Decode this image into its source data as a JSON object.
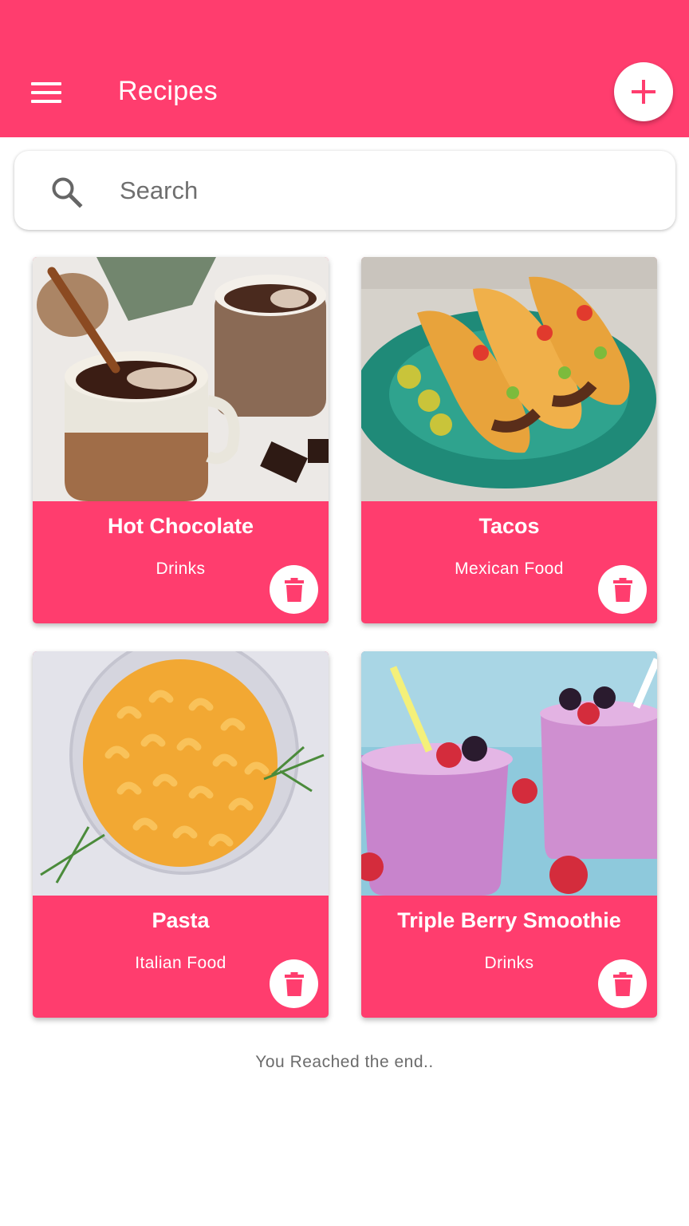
{
  "app_bar": {
    "title": "Recipes",
    "menu_icon": "hamburger-menu-icon",
    "add_icon": "plus-icon",
    "color": "#ff3d6e"
  },
  "search": {
    "placeholder": "Search",
    "value": "",
    "icon": "search-icon"
  },
  "recipes": [
    {
      "title": "Hot Chocolate",
      "category": "Drinks",
      "image": "hot-chocolate-photo",
      "delete_icon": "trash-icon"
    },
    {
      "title": "Tacos",
      "category": "Mexican Food",
      "image": "tacos-photo",
      "delete_icon": "trash-icon"
    },
    {
      "title": "Pasta",
      "category": "Italian Food",
      "image": "pasta-photo",
      "delete_icon": "trash-icon"
    },
    {
      "title": "Triple Berry Smoothie",
      "category": "Drinks",
      "image": "smoothie-photo",
      "delete_icon": "trash-icon"
    }
  ],
  "footer": {
    "end_message": "You Reached the end.."
  },
  "colors": {
    "accent": "#ff3d6e",
    "card_text": "#ffffff",
    "muted_text": "#6c6c6c"
  }
}
